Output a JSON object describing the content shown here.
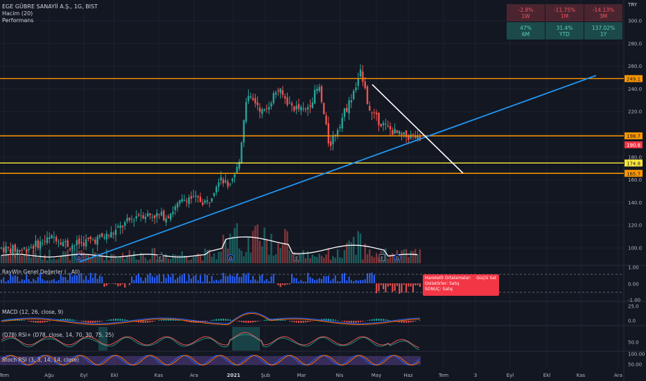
{
  "header": {
    "symbol": "EGE GÜBRE SANAYİİ A.Ş., 1G, BIST",
    "volume_label": "Hacim (20)",
    "performance_label": "Performans"
  },
  "currency": "TRY",
  "performance": [
    {
      "value": "-2.8%",
      "period": "1W",
      "sign": "neg"
    },
    {
      "value": "-11.75%",
      "period": "1M",
      "sign": "neg"
    },
    {
      "value": "-14.13%",
      "period": "3M",
      "sign": "neg"
    },
    {
      "value": "47%",
      "period": "6M",
      "sign": "pos"
    },
    {
      "value": "31.4%",
      "period": "YTD",
      "sign": "pos"
    },
    {
      "value": "137.02%",
      "period": "1Y",
      "sign": "pos"
    }
  ],
  "price_axis": [
    "300.0",
    "280.0",
    "260.0",
    "240.0",
    "220.0",
    "200.0",
    "180.0",
    "160.0",
    "140.0",
    "120.0",
    "100.0"
  ],
  "price_tags": [
    {
      "text": "249.1",
      "color": "#ff9800",
      "text_color": "#131722"
    },
    {
      "text": "198.7",
      "color": "#ff9800",
      "text_color": "#131722"
    },
    {
      "text": "190.8",
      "color": "#f23645",
      "text_color": "#ffffff"
    },
    {
      "text": "174.8",
      "color": "#ffeb3b",
      "text_color": "#131722"
    },
    {
      "text": "165.7",
      "color": "#ff9800",
      "text_color": "#131722"
    }
  ],
  "time_axis": [
    "Tem",
    "Ağu",
    "Eyl",
    "Ekl",
    "Kas",
    "Ara",
    "2021",
    "Şub",
    "Mar",
    "Nis",
    "May",
    "Haz",
    "Tem",
    "3",
    "Eyl",
    "Ekl",
    "Kas",
    "Ara"
  ],
  "events": [
    "D",
    "E",
    "D",
    "E",
    "E",
    "D"
  ],
  "panes": {
    "raywin": {
      "label": "RayWin Genel Değerler ( , All)",
      "axis": [
        "1.00",
        "0.00",
        "-1.00"
      ]
    },
    "macd": {
      "label": "MACD (12, 26, close, 9)",
      "axis": [
        "25.0",
        "0.0"
      ]
    },
    "drsi": {
      "label": "(D78) RSI+ (D78, close, 14, 70, 30, 75, 25)",
      "axis": [
        "50.0"
      ]
    },
    "stoch": {
      "label": "Stoch RSI (3, 3, 14, 14, close)",
      "axis": [
        "100.00",
        "50.00"
      ]
    }
  },
  "tooltip": {
    "row1_label": "Hareketli Ortalamalar:",
    "row1_value": "Güçlü Sat",
    "row2": "Osilatörler: Satış",
    "row3": "SONUÇ:  Satış"
  },
  "colors": {
    "background": "#131722",
    "up": "#26a69a",
    "down": "#ef5350",
    "level_orange": "#ff9800",
    "level_yellow": "#ffeb3b",
    "trend_blue": "#2196f3",
    "trend_white": "#ffffff"
  }
}
